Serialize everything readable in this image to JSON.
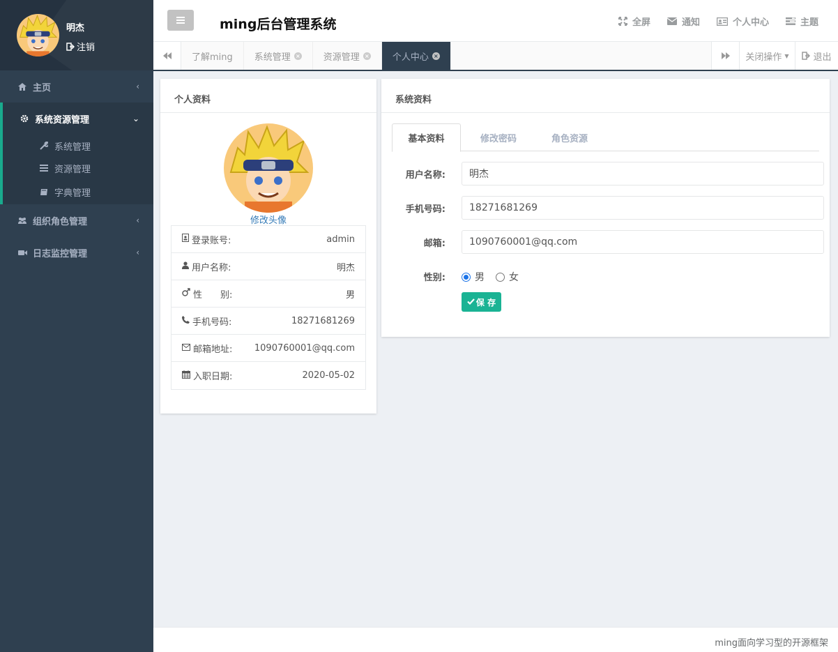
{
  "sidebar": {
    "user_name": "明杰",
    "logout_label": "注销",
    "nav": {
      "home": "主页",
      "system_resource": "系统资源管理",
      "sub_system": "系统管理",
      "sub_resource": "资源管理",
      "sub_dict": "字典管理",
      "org_role": "组织角色管理",
      "log_monitor": "日志监控管理"
    }
  },
  "header": {
    "title": "ming后台管理系统",
    "fullscreen": "全屏",
    "notify": "通知",
    "personal_center": "个人中心",
    "theme": "主题"
  },
  "tabs": {
    "items": [
      "了解ming",
      "系统管理",
      "资源管理",
      "个人中心"
    ],
    "close_ops": "关闭操作",
    "exit": "退出"
  },
  "profile_panel": {
    "title": "个人资料",
    "change_avatar": "修改头像",
    "rows": [
      {
        "label": "登录账号:",
        "value": "admin"
      },
      {
        "label": "用户名称:",
        "value": "明杰"
      },
      {
        "label": "性　　别:",
        "value": "男"
      },
      {
        "label": "手机号码:",
        "value": "18271681269"
      },
      {
        "label": "邮箱地址:",
        "value": "1090760001@qq.com"
      },
      {
        "label": "入职日期:",
        "value": "2020-05-02"
      }
    ]
  },
  "system_panel": {
    "title": "系统资料",
    "tabs": [
      "基本资料",
      "修改密码",
      "角色资源"
    ],
    "form": {
      "username_label": "用户名称:",
      "username_value": "明杰",
      "phone_label": "手机号码:",
      "phone_value": "18271681269",
      "email_label": "邮箱:",
      "email_value": "1090760001@qq.com",
      "gender_label": "性别:",
      "male": "男",
      "female": "女",
      "save": "保 存"
    }
  },
  "footer": {
    "text": "ming面向学习型的开源框架"
  },
  "colors": {
    "accent": "#1ab394",
    "sidebar": "#2f4050",
    "link": "#337ab7"
  }
}
